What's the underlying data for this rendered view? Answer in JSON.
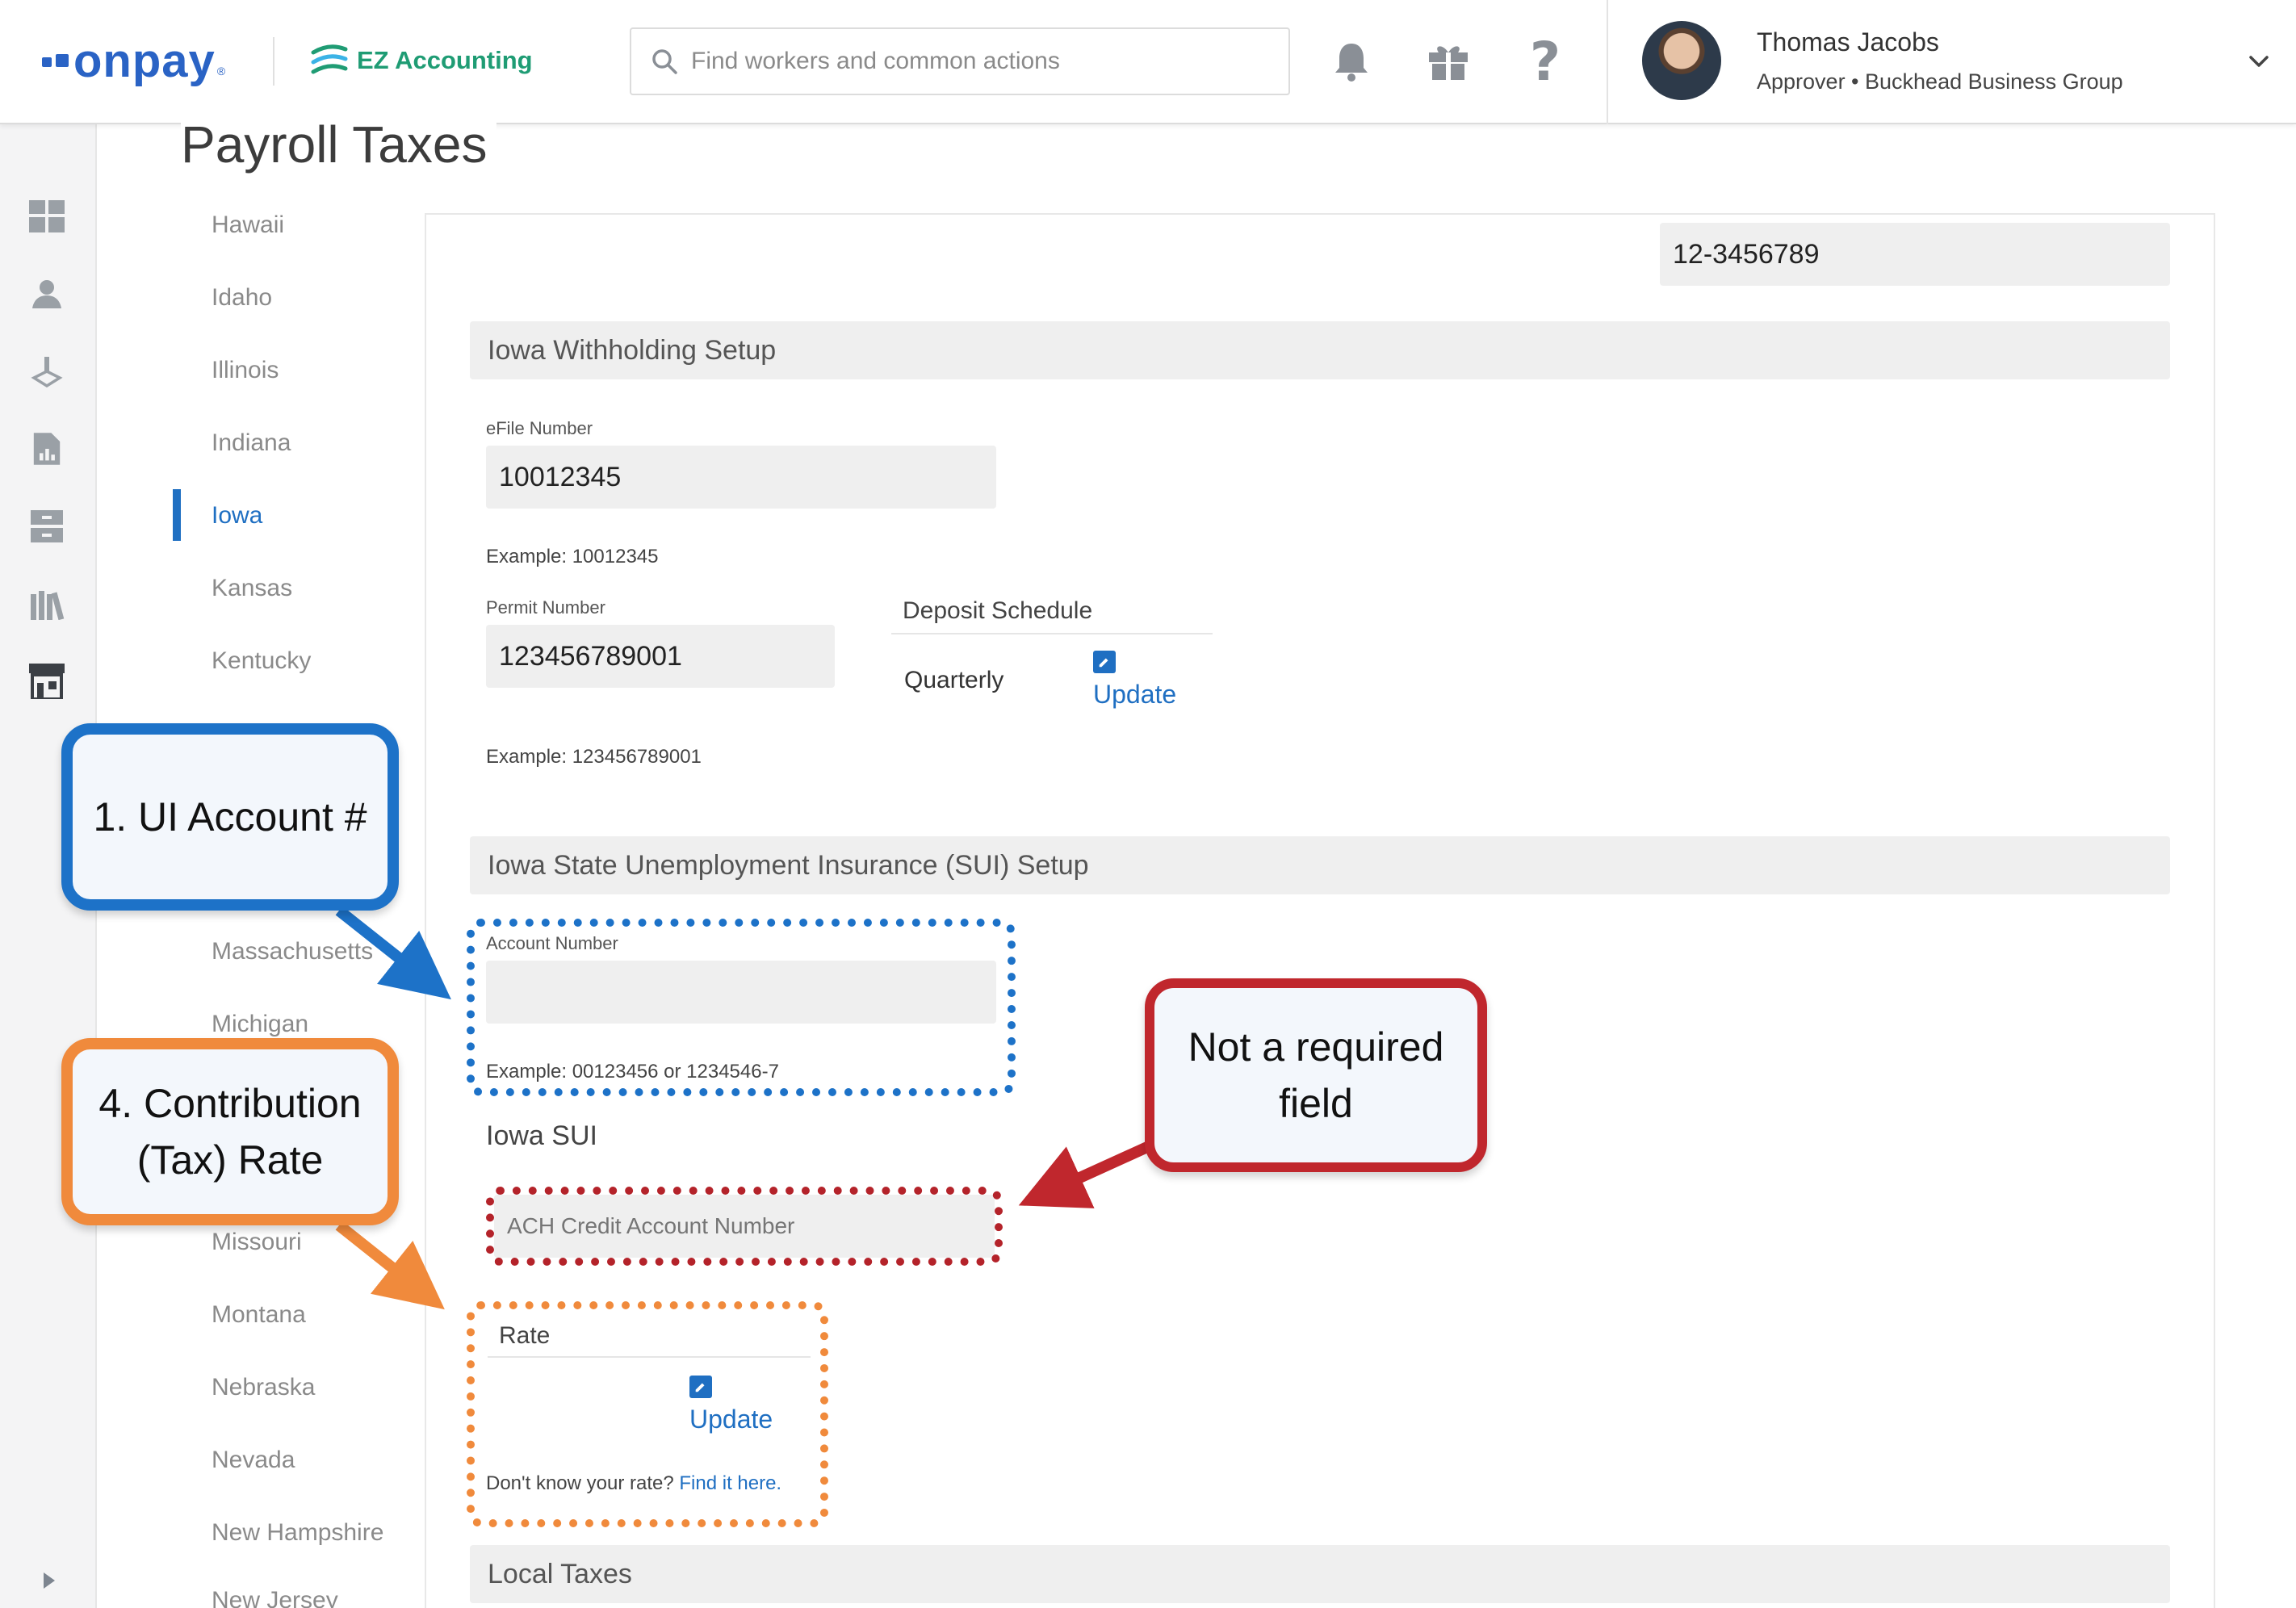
{
  "header": {
    "logo_text": "onpay",
    "logo_reg": "®",
    "partner_logo_text": "EZ Accounting",
    "search_placeholder": "Find workers and common actions",
    "user_name": "Thomas Jacobs",
    "user_role": "Approver • Buckhead Business Group"
  },
  "rail": {
    "icons": [
      "dashboard-icon",
      "people-icon",
      "payroll-icon",
      "reports-icon",
      "filing-cabinet-icon",
      "library-icon",
      "store-icon"
    ]
  },
  "page": {
    "title": "Payroll Taxes"
  },
  "states": [
    "Hawaii",
    "Idaho",
    "Illinois",
    "Indiana",
    "Iowa",
    "Kansas",
    "Kentucky",
    "Massachusetts",
    "Michigan",
    "Missouri",
    "Montana",
    "Nebraska",
    "Nevada",
    "New Hampshire",
    "New Jersey"
  ],
  "states_active": "Iowa",
  "form": {
    "top_id_value": "12-3456789",
    "withholding": {
      "title": "Iowa Withholding Setup",
      "efile_label": "eFile Number",
      "efile_value": "10012345",
      "efile_example": "Example: 10012345",
      "permit_label": "Permit Number",
      "permit_value": "123456789001",
      "permit_example": "Example: 123456789001",
      "deposit_label": "Deposit Schedule",
      "deposit_value": "Quarterly",
      "update_label": "Update"
    },
    "sui": {
      "title": "Iowa State Unemployment Insurance (SUI) Setup",
      "account_label": "Account Number",
      "account_value": "",
      "account_example": "Example: 00123456 or 1234546-7",
      "sui_heading": "Iowa SUI",
      "ach_placeholder": "ACH Credit Account Number",
      "rate_label": "Rate",
      "update_label": "Update",
      "rate_help": "Don't know your rate?",
      "rate_help_link": "Find it here."
    },
    "local_taxes_title": "Local Taxes"
  },
  "annotations": {
    "ui_account": "1. UI Account #",
    "contribution_line1": "4. Contribution",
    "contribution_line2": "(Tax) Rate",
    "not_required_line1": "Not a required",
    "not_required_line2": "field"
  },
  "colors": {
    "brand_blue": "#2a63c5",
    "link_blue": "#1f6fc2",
    "ez_green": "#1f9c74",
    "annotation_blue": "#1d72c8",
    "annotation_orange": "#f08a3c",
    "annotation_red": "#c0272d"
  }
}
